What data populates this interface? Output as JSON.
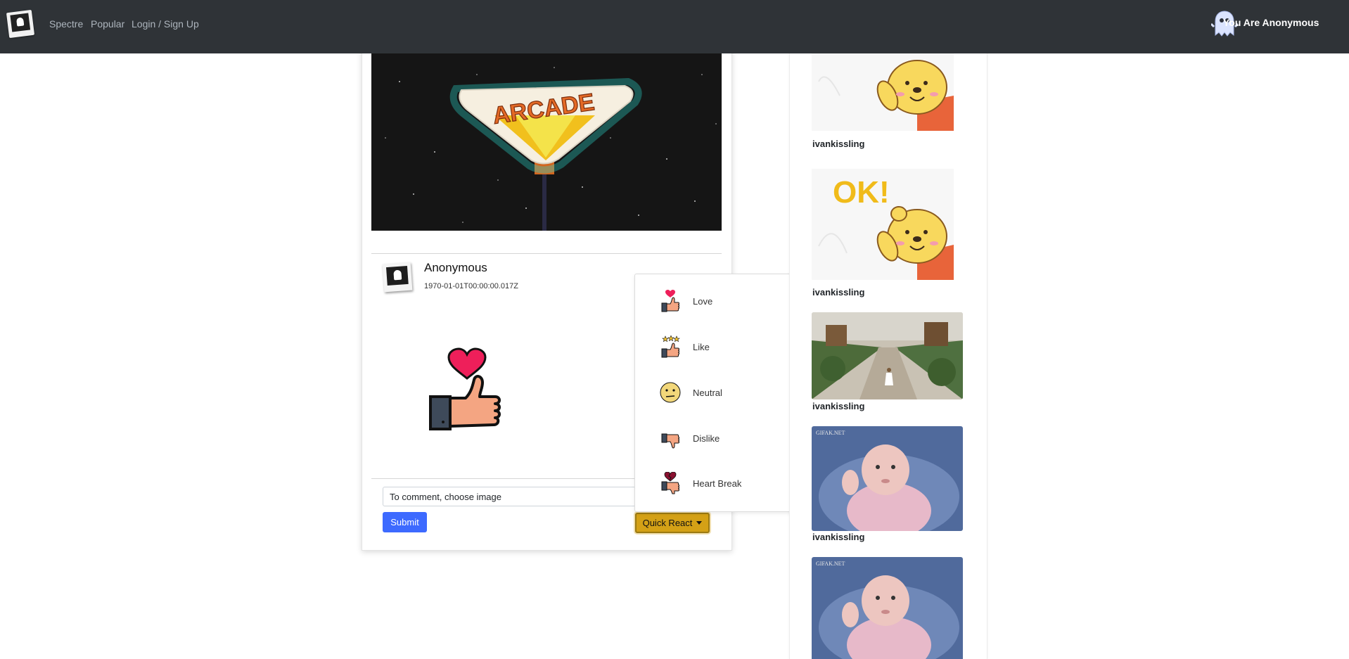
{
  "navbar": {
    "links": [
      "Spectre",
      "Popular",
      "Login / Sign Up"
    ],
    "user_label": "You Are Anonymous"
  },
  "post": {
    "author": "Anonymous",
    "timestamp": "1970-01-01T00:00:00.017Z",
    "image_sign_text": "ARCADE",
    "comment_placeholder": "To comment, choose image",
    "submit_label": "Submit",
    "quick_react_label": "Quick React"
  },
  "reactions": [
    {
      "label": "Love",
      "icon": "love-icon"
    },
    {
      "label": "Like",
      "icon": "like-icon"
    },
    {
      "label": "Neutral",
      "icon": "neutral-icon"
    },
    {
      "label": "Dislike",
      "icon": "dislike-icon"
    },
    {
      "label": "Heart Break",
      "icon": "heart-break-icon"
    }
  ],
  "feed": [
    {
      "user": "ivankissling",
      "image": "winnie-ok-gif"
    },
    {
      "user": "ivankissling",
      "image": "winnie-ok-text-gif",
      "overlay_text": "OK!"
    },
    {
      "user": "ivankissling",
      "image": "garden-path-photo"
    },
    {
      "user": "ivankissling",
      "image": "baby-thumbs-up-gif",
      "watermark": "GIFAK.NET"
    },
    {
      "user": "",
      "image": "baby-thumbs-up-gif",
      "watermark": "GIFAK.NET"
    }
  ],
  "colors": {
    "navbar": "#2f3337",
    "submit": "#3d6aff",
    "quick_react": "#d4a116"
  }
}
